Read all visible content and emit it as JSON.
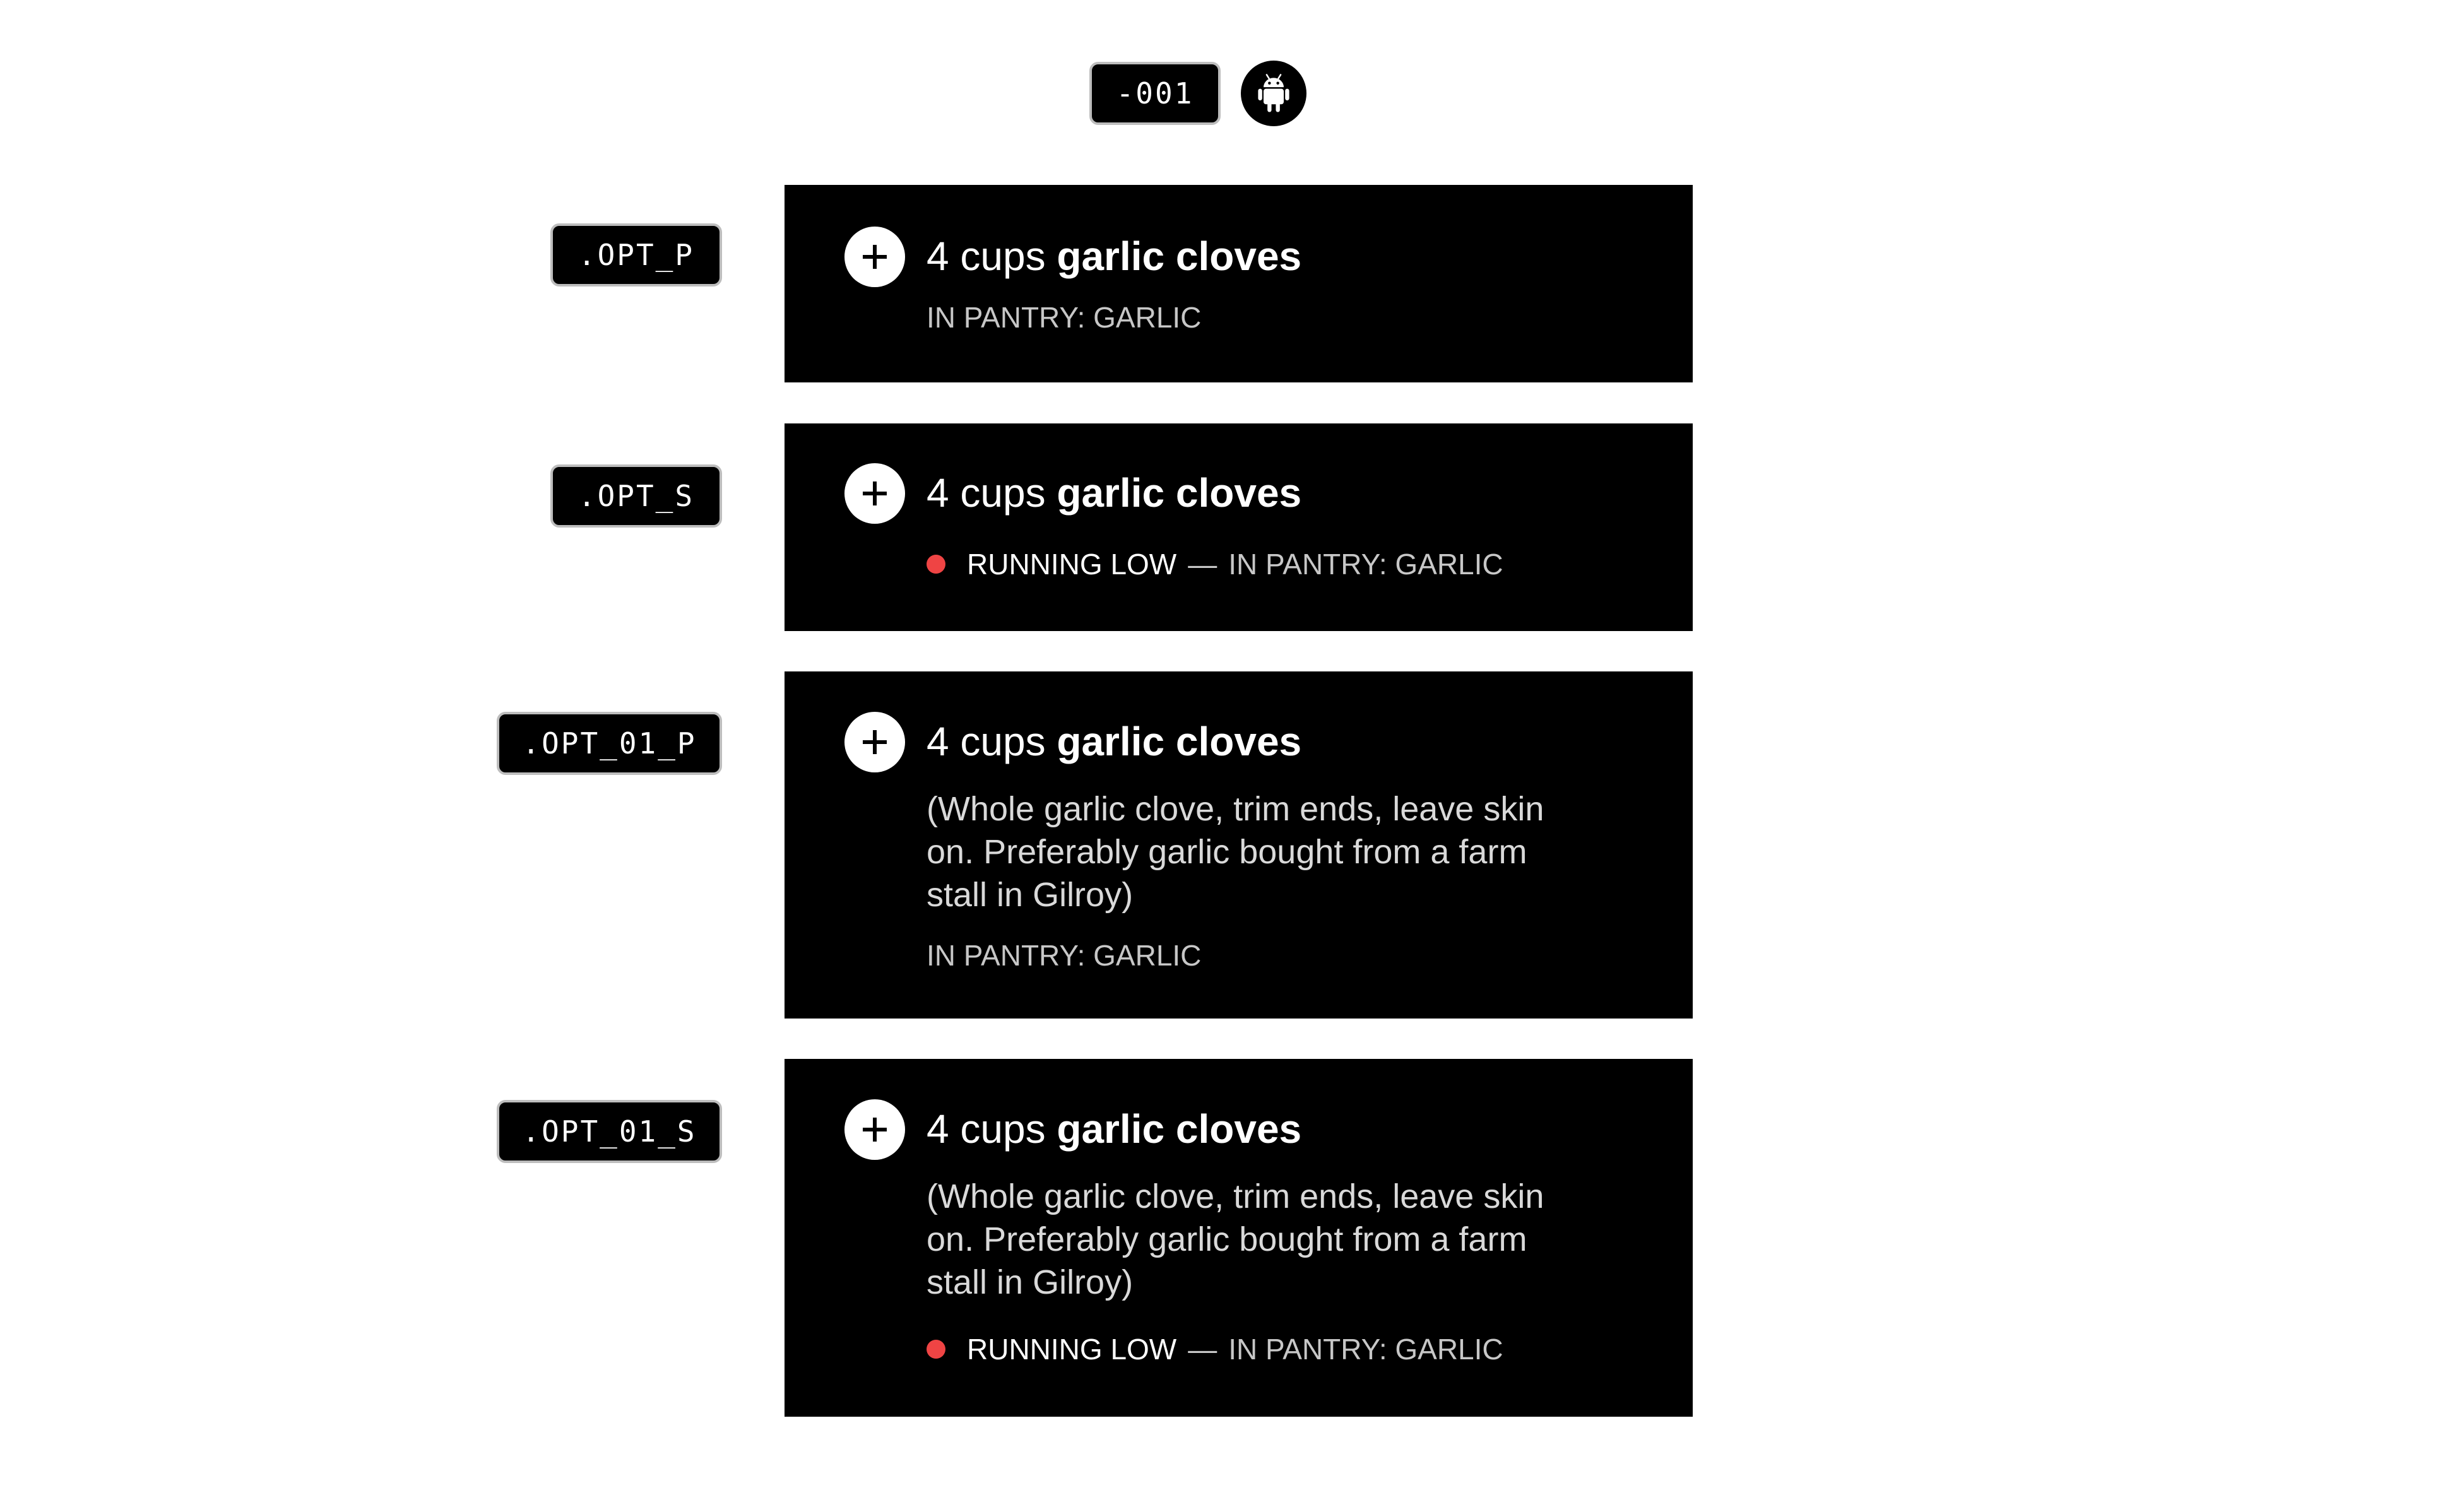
{
  "header": {
    "version_tag": "-001",
    "platform_icon": "android-icon"
  },
  "colors": {
    "card_bg": "#000000",
    "low_stock_dot": "#ef4444"
  },
  "variants": [
    {
      "tag": ".OPT_P",
      "quantity": "4 cups",
      "ingredient": "garlic cloves",
      "pantry": "IN PANTRY: GARLIC"
    },
    {
      "tag": ".OPT_S",
      "quantity": "4 cups",
      "ingredient": "garlic cloves",
      "status": "RUNNING LOW",
      "separator": "—",
      "pantry": "IN PANTRY: GARLIC"
    },
    {
      "tag": ".OPT_01_P",
      "quantity": "4 cups",
      "ingredient": "garlic cloves",
      "note": "(Whole garlic clove, trim ends, leave skin on. Preferably garlic bought from a farm stall in Gilroy)",
      "pantry": "IN PANTRY: GARLIC"
    },
    {
      "tag": ".OPT_01_S",
      "quantity": "4 cups",
      "ingredient": "garlic cloves",
      "note": "(Whole garlic clove, trim ends, leave skin on. Preferably garlic bought from a farm stall in Gilroy)",
      "status": "RUNNING LOW",
      "separator": "—",
      "pantry": "IN PANTRY: GARLIC"
    }
  ]
}
